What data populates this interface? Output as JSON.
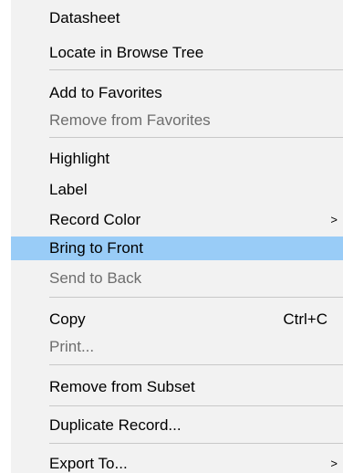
{
  "context_menu": {
    "items": [
      {
        "label": "Datasheet"
      },
      {
        "label": "Locate in Browse Tree"
      },
      {
        "label": "Add to Favorites"
      },
      {
        "label": "Remove from Favorites",
        "disabled": true
      },
      {
        "label": "Highlight"
      },
      {
        "label": "Label"
      },
      {
        "label": "Record Color",
        "submenu_icon": "chevron-right-icon",
        "submenu_glyph": ">"
      },
      {
        "label": "Bring to Front",
        "highlighted": true
      },
      {
        "label": "Send to Back",
        "disabled": true
      },
      {
        "label": "Copy",
        "shortcut": "Ctrl+C"
      },
      {
        "label": "Print...",
        "disabled": true
      },
      {
        "label": "Remove from Subset"
      },
      {
        "label": "Duplicate Record..."
      },
      {
        "label": "Export To...",
        "submenu_icon": "chevron-right-icon",
        "submenu_glyph": ">"
      }
    ]
  },
  "colors": {
    "menu_background": "#f2f2f2",
    "highlight_background": "#99ccf7",
    "disabled_text": "#6d6d6d",
    "separator": "#c8c8c8"
  }
}
